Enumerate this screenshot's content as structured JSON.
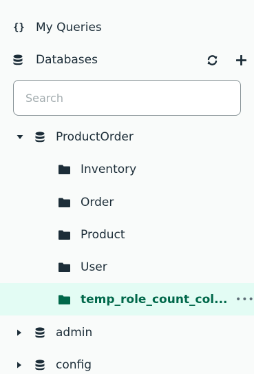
{
  "sidebar": {
    "my_queries_icon": "{}",
    "my_queries_label": "My Queries",
    "databases_label": "Databases",
    "search_placeholder": "Search",
    "databases": [
      {
        "name": "ProductOrder",
        "expanded": true,
        "collections": [
          "Inventory",
          "Order",
          "Product",
          "User",
          "temp_role_count_col..."
        ]
      },
      {
        "name": "admin",
        "expanded": false
      },
      {
        "name": "config",
        "expanded": false
      }
    ],
    "selected_collection": "temp_role_count_col...",
    "more_menu_glyph": "•••"
  },
  "colors": {
    "background": "#f9fbfa",
    "text": "#1c2d38",
    "selected_background": "#e3fcf4",
    "selected_text": "#00684a",
    "input_border": "#889397"
  },
  "icons": {
    "queries": "curly-braces-icon",
    "database": "database-icon",
    "refresh": "refresh-icon",
    "add": "plus-icon",
    "collection": "folder-icon",
    "expanded": "caret-down-icon",
    "collapsed": "caret-right-icon",
    "more": "ellipsis-icon"
  }
}
